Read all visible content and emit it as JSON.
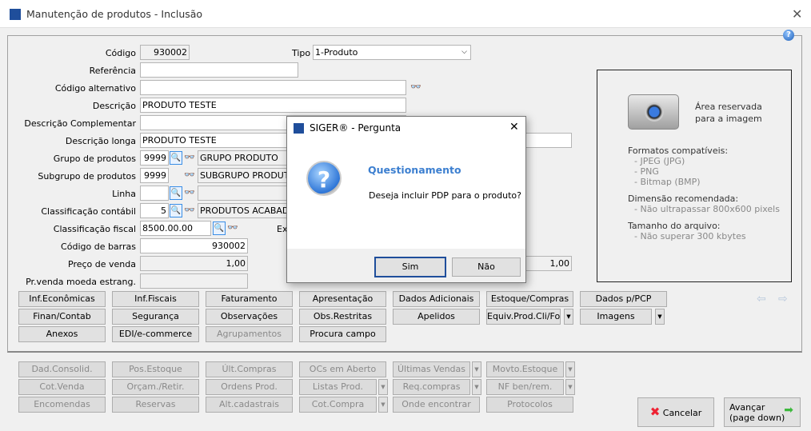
{
  "window": {
    "title": "Manutenção de produtos - Inclusão",
    "close": "✕"
  },
  "form": {
    "codigo": {
      "label": "Código",
      "value": "930002"
    },
    "tipo": {
      "label": "Tipo",
      "value": "1-Produto"
    },
    "referencia": {
      "label": "Referência",
      "value": ""
    },
    "codigo_alternativo": {
      "label": "Código alternativo",
      "value": ""
    },
    "descricao": {
      "label": "Descrição",
      "value": "PRODUTO TESTE"
    },
    "descricao_complementar": {
      "label": "Descrição Complementar",
      "value": ""
    },
    "descricao_longa": {
      "label": "Descrição longa",
      "value": "PRODUTO TESTE"
    },
    "grupo": {
      "label": "Grupo de produtos",
      "code": "9999",
      "desc": "GRUPO PRODUTO"
    },
    "subgrupo": {
      "label": "Subgrupo de produtos",
      "code": "9999",
      "desc": "SUBGRUPO PRODUTOS"
    },
    "linha": {
      "label": "Linha",
      "code": "",
      "desc": ""
    },
    "classificacao_contabil": {
      "label": "Classificação contábil",
      "code": "5",
      "desc": "PRODUTOS ACABADOS"
    },
    "classificacao_fiscal": {
      "label": "Classificação fiscal",
      "value": "8500.00.00",
      "ex_label": "Ex"
    },
    "codigo_barras": {
      "label": "Código de barras",
      "value": "930002"
    },
    "preco_venda": {
      "label": "Preço de venda",
      "value": "1,00"
    },
    "preco_moeda": {
      "label": "Pr.venda moeda estrang.",
      "value": ""
    },
    "extra_value": "1,00"
  },
  "image_area": {
    "title1": "Área reservada",
    "title2": "para a imagem",
    "formats_title": "Formatos compatíveis:",
    "formats": [
      "- JPEG (JPG)",
      "- PNG",
      "- Bitmap (BMP)"
    ],
    "dim_title": "Dimensão recomendada:",
    "dim": "- Não ultrapassar 800x600 pixels",
    "size_title": "Tamanho do arquivo:",
    "size": "- Não superar 300 kbytes"
  },
  "tab_buttons": [
    [
      "Inf.Econômicas",
      "Inf.Fiscais",
      "Faturamento",
      "Apresentação",
      "Dados Adicionais",
      "Estoque/Compras",
      "Dados p/PCP"
    ],
    [
      "Finan/Contab",
      "Segurança",
      "Observações",
      "Obs.Restritas",
      "Apelidos",
      "Equiv.Prod.Cli/For",
      "Imagens"
    ],
    [
      "Anexos",
      "EDI/e-commerce",
      "Agrupamentos",
      "Procura campo"
    ]
  ],
  "bottom_buttons": [
    [
      "Dad.Consolid.",
      "Pos.Estoque",
      "Últ.Compras",
      "OCs em Aberto",
      "Últimas Vendas",
      "Movto.Estoque"
    ],
    [
      "Cot.Venda",
      "Orçam./Retir.",
      "Ordens Prod.",
      "Listas Prod.",
      "Req.compras",
      "NF ben/rem."
    ],
    [
      "Encomendas",
      "Reservas",
      "Alt.cadastrais",
      "Cot.Compra",
      "Onde encontrar",
      "Protocolos"
    ]
  ],
  "actions": {
    "cancel": "Cancelar",
    "next1": "Avançar",
    "next2": "(page down)"
  },
  "dialog": {
    "title": "SIGER® - Pergunta",
    "heading": "Questionamento",
    "message": "Deseja incluir PDP para o produto?",
    "yes": "Sim",
    "no": "Não",
    "close": "✕"
  },
  "colors": {
    "heading": "#3c7fd0",
    "accent": "#1f4e9b"
  }
}
